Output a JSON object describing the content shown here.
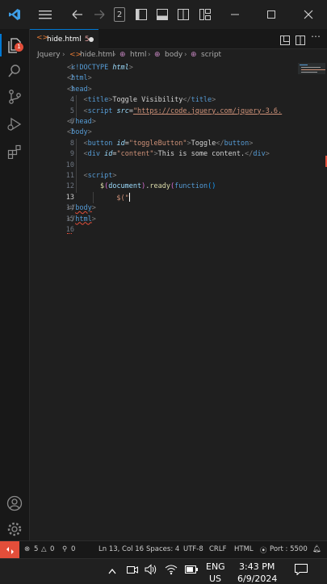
{
  "titlebar": {
    "badge_count": "2",
    "icons": [
      "vscode-logo-icon",
      "menu-icon",
      "back-arrow-icon",
      "forward-arrow-icon",
      "toggle-sidebar-icon",
      "toggle-panel-icon",
      "toggle-secondary-sidebar-icon",
      "customize-layout-icon",
      "minimize-icon",
      "maximize-icon",
      "close-icon"
    ]
  },
  "tab": {
    "label": "hide.html",
    "problems": "5"
  },
  "breadcrumb": {
    "folder": "Jquery",
    "file": "hide.html",
    "html": "html",
    "body": "body",
    "script": "script"
  },
  "editor": {
    "line_numbers": [
      "1",
      "2",
      "3",
      "4",
      "5",
      "6",
      "7",
      "8",
      "9",
      "10",
      "11",
      "12",
      "13",
      "14",
      "15",
      "16"
    ],
    "active_line": "13",
    "lines": {
      "l1a": "<!DOCTYPE ",
      "l1b": "html",
      "l1c": ">",
      "l4_title_text": "Toggle Visibility",
      "l5_src_value": "\"https://code.jquery.com/jquery-3.6.",
      "l7_id_value": "\"toggleButton\"",
      "l7_text": "Toggle",
      "l8_id_value": "\"content\"",
      "l8_text": "This is some content.",
      "l12_document": "document",
      "l12_ready": "ready",
      "l12_function": "function",
      "l13": "$(\""
    }
  },
  "status": {
    "errors": "5",
    "warnings": "0",
    "ports_forwarded": "0",
    "position": "Ln 13, Col 16",
    "spaces": "Spaces: 4",
    "encoding": "UTF-8",
    "eol": "CRLF",
    "language": "HTML",
    "port": "Port : 5500"
  },
  "taskbar": {
    "lang_top": "ENG",
    "lang_bottom": "US",
    "time": "3:43 PM",
    "date": "6/9/2024"
  },
  "colors": {
    "accent": "#0078d4",
    "error_red": "#e24e3a",
    "editor_bg": "#1f1f1f"
  }
}
